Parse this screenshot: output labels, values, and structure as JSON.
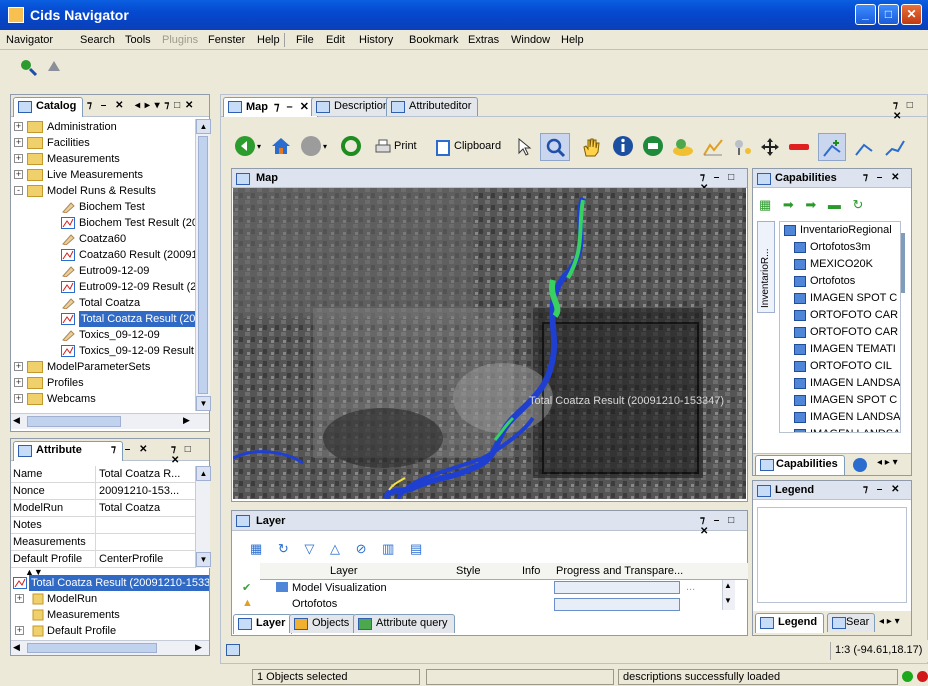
{
  "window": {
    "title": "Cids Navigator"
  },
  "menus": {
    "left": [
      "Navigator",
      "Search",
      "Tools",
      "Plugins",
      "Fenster",
      "Help"
    ],
    "disabled_index": 3,
    "right": [
      "File",
      "Edit",
      "History",
      "Bookmark",
      "Extras",
      "Window",
      "Help"
    ]
  },
  "catalog": {
    "tab": "Catalog",
    "items": [
      {
        "label": "Administration",
        "type": "folder",
        "level": 0,
        "exp": "+"
      },
      {
        "label": "Facilities",
        "type": "folder",
        "level": 0,
        "exp": "+"
      },
      {
        "label": "Measurements",
        "type": "folder",
        "level": 0,
        "exp": "+"
      },
      {
        "label": "Live Measurements",
        "type": "folder",
        "level": 0,
        "exp": "+"
      },
      {
        "label": "Model Runs & Results",
        "type": "folder",
        "level": 0,
        "exp": "-"
      },
      {
        "label": "Biochem Test",
        "type": "pencil",
        "level": 1
      },
      {
        "label": "Biochem Test Result (200",
        "type": "chart",
        "level": 1
      },
      {
        "label": "Coatza60",
        "type": "pencil",
        "level": 1
      },
      {
        "label": "Coatza60 Result (200912",
        "type": "chart",
        "level": 1
      },
      {
        "label": "Eutro09-12-09",
        "type": "pencil",
        "level": 1
      },
      {
        "label": "Eutro09-12-09 Result (20",
        "type": "chart",
        "level": 1
      },
      {
        "label": "Total Coatza",
        "type": "pencil",
        "level": 1
      },
      {
        "label": "Total Coatza Result (200",
        "type": "chart",
        "level": 1,
        "selected": true
      },
      {
        "label": "Toxics_09-12-09",
        "type": "pencil",
        "level": 1
      },
      {
        "label": "Toxics_09-12-09 Result (",
        "type": "chart",
        "level": 1
      },
      {
        "label": "ModelParameterSets",
        "type": "folder",
        "level": 0,
        "exp": "+"
      },
      {
        "label": "Profiles",
        "type": "folder",
        "level": 0,
        "exp": "+"
      },
      {
        "label": "Webcams",
        "type": "folder",
        "level": 0,
        "exp": "+"
      }
    ]
  },
  "attribute": {
    "tab": "Attribute",
    "rows": [
      {
        "k": "Name",
        "v": "Total Coatza R..."
      },
      {
        "k": "Nonce",
        "v": "20091210-153..."
      },
      {
        "k": "ModelRun",
        "v": "Total Coatza"
      },
      {
        "k": "Notes",
        "v": ""
      },
      {
        "k": "Measurements",
        "v": ""
      },
      {
        "k": "Default Profile",
        "v": "CenterProfile"
      }
    ],
    "tree": [
      {
        "label": "Total Coatza Result (20091210-1533",
        "level": 0,
        "selected": true
      },
      {
        "label": "ModelRun",
        "level": 1,
        "exp": "+"
      },
      {
        "label": "Measurements",
        "level": 1
      },
      {
        "label": "Default Profile",
        "level": 1,
        "exp": "+"
      }
    ]
  },
  "center_tabs": [
    {
      "label": "Map",
      "active": true
    },
    {
      "label": "Description"
    },
    {
      "label": "Attributeditor"
    }
  ],
  "toolbar": {
    "print": "Print",
    "clipboard": "Clipboard"
  },
  "map": {
    "title": "Map",
    "overlay_label": "Total Coatza Result (20091210-153347)"
  },
  "layer": {
    "title": "Layer",
    "columns": [
      "Layer",
      "Style",
      "Info",
      "Progress and Transpare..."
    ],
    "rows": [
      "Model Visualization",
      "Ortofotos"
    ],
    "bottom_tabs": [
      "Layer",
      "Objects",
      "Attribute query"
    ]
  },
  "capabilities": {
    "title": "Capabilities",
    "side_label": "InventarioR...",
    "root": "InventarioRegional",
    "items": [
      "Ortofotos3m",
      "MEXICO20K",
      "Ortofotos",
      "IMAGEN SPOT C",
      "ORTOFOTO CAR",
      "ORTOFOTO CAR",
      "IMAGEN TEMATI",
      "ORTOFOTO CIL",
      "IMAGEN LANDSA",
      "IMAGEN SPOT C",
      "IMAGEN LANDSA",
      "IMAGEN LANDSA"
    ],
    "tab": "Capabilities"
  },
  "legend": {
    "title": "Legend",
    "tab": "Legend",
    "tab2": "Sear"
  },
  "map_footer": {
    "scale": "1:3",
    "coords": "(-94.61,18.17)"
  },
  "status": {
    "selected": "1 Objects selected",
    "middle": "",
    "message": "descriptions successfully loaded"
  },
  "colors": {
    "river_blue": "#1f3fd0",
    "river_green": "#38d060",
    "status_green": "#1ea81e",
    "status_red": "#d01a1a",
    "selection": "#316ac5"
  }
}
